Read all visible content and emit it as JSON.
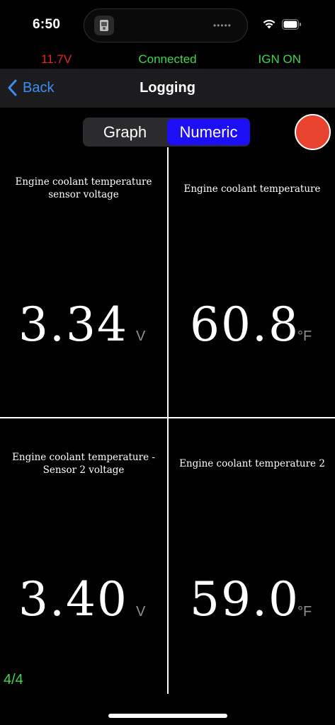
{
  "status_bar": {
    "time": "6:50",
    "island_dots": "•••••",
    "icons": [
      "app-icon",
      "wifi-icon",
      "battery-icon"
    ]
  },
  "connection": {
    "voltage": "11.7V",
    "status": "Connected",
    "ignition": "IGN ON",
    "colors": {
      "voltage": "#e02a20",
      "ok": "#3fd64a"
    }
  },
  "nav": {
    "back_label": "Back",
    "title": "Logging"
  },
  "segments": {
    "graph": "Graph",
    "numeric": "Numeric",
    "selected": "Numeric",
    "accent": "#1c0ef5"
  },
  "record": {
    "color": "#e8432e"
  },
  "cells": [
    {
      "label": "Engine coolant temperature sensor voltage",
      "value": "3.34",
      "unit": "V"
    },
    {
      "label": "Engine coolant temperature",
      "value": "60.8",
      "unit": "°F"
    },
    {
      "label": "Engine coolant temperature  - Sensor 2 voltage",
      "value": "3.40",
      "unit": "V"
    },
    {
      "label": "Engine coolant temperature 2",
      "value": "59.0",
      "unit": "°F"
    }
  ],
  "page_indicator": "4/4"
}
